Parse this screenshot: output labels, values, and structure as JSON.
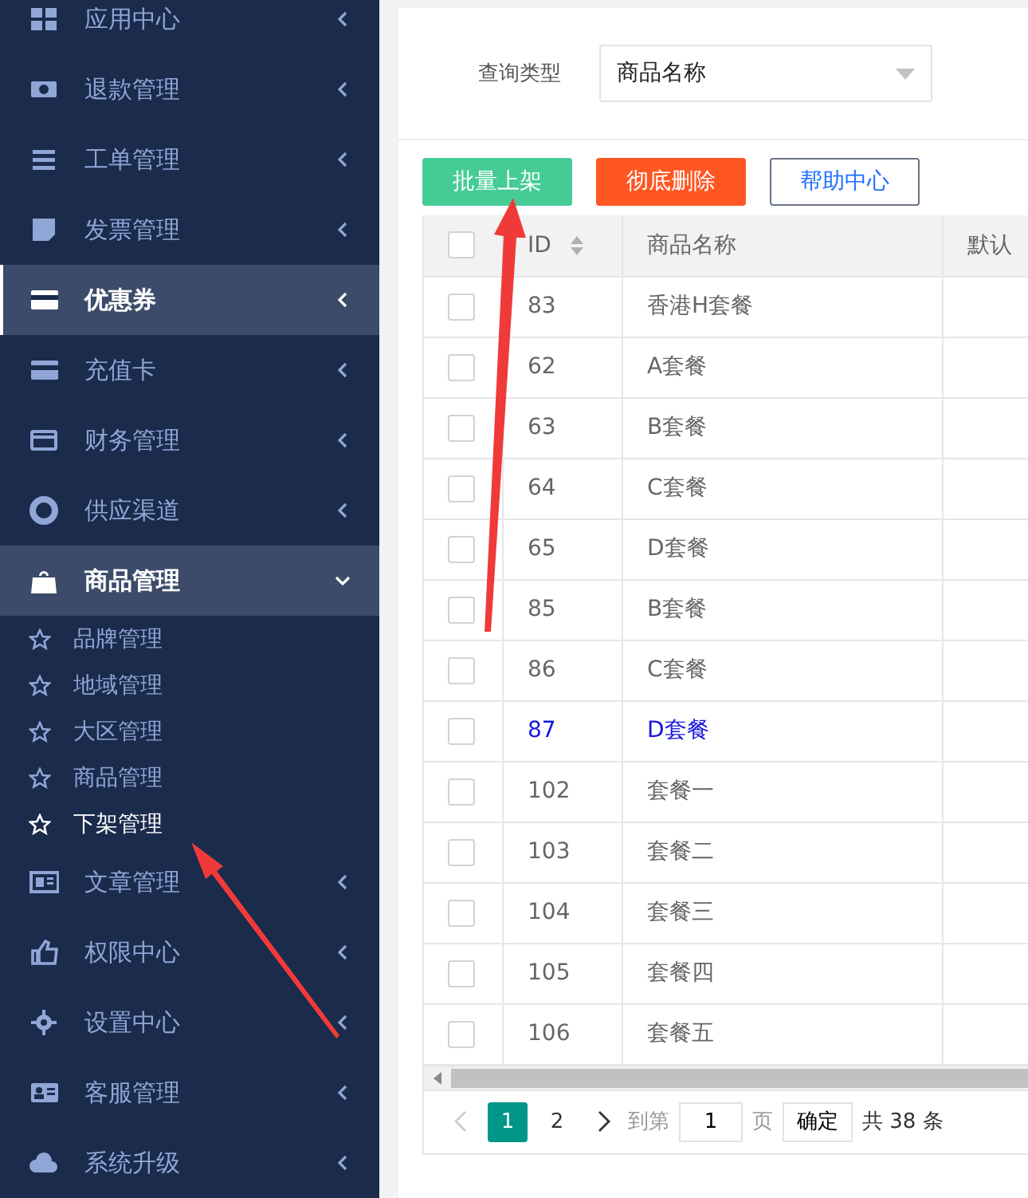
{
  "sidebar": {
    "items": [
      {
        "label": "应用中心",
        "selected": false,
        "expanded": false
      },
      {
        "label": "退款管理",
        "selected": false,
        "expanded": false
      },
      {
        "label": "工单管理",
        "selected": false,
        "expanded": false
      },
      {
        "label": "发票管理",
        "selected": false,
        "expanded": false
      },
      {
        "label": "优惠券",
        "selected": true,
        "expanded": false
      },
      {
        "label": "充值卡",
        "selected": false,
        "expanded": false
      },
      {
        "label": "财务管理",
        "selected": false,
        "expanded": false
      },
      {
        "label": "供应渠道",
        "selected": false,
        "expanded": false
      },
      {
        "label": "商品管理",
        "selected": false,
        "expanded": true,
        "children": [
          {
            "label": "品牌管理",
            "selected": false
          },
          {
            "label": "地域管理",
            "selected": false
          },
          {
            "label": "大区管理",
            "selected": false
          },
          {
            "label": "商品管理",
            "selected": false
          },
          {
            "label": "下架管理",
            "selected": true
          }
        ]
      },
      {
        "label": "文章管理",
        "selected": false,
        "expanded": false
      },
      {
        "label": "权限中心",
        "selected": false,
        "expanded": false
      },
      {
        "label": "设置中心",
        "selected": false,
        "expanded": false
      },
      {
        "label": "客服管理",
        "selected": false,
        "expanded": false
      },
      {
        "label": "系统升级",
        "selected": false,
        "expanded": false
      }
    ]
  },
  "filter": {
    "label": "查询类型",
    "value": "商品名称"
  },
  "buttons": [
    {
      "label": "批量上架",
      "kind": "primary"
    },
    {
      "label": "彻底删除",
      "kind": "danger"
    },
    {
      "label": "帮助中心",
      "kind": "outline"
    }
  ],
  "table": {
    "all_checked": false,
    "columns": [
      "ID",
      "商品名称",
      "默认"
    ],
    "rows": [
      {
        "id": "83",
        "name": "香港H套餐",
        "checked": false,
        "highlighted": false
      },
      {
        "id": "62",
        "name": "A套餐",
        "checked": false,
        "highlighted": false
      },
      {
        "id": "63",
        "name": "B套餐",
        "checked": false,
        "highlighted": false
      },
      {
        "id": "64",
        "name": "C套餐",
        "checked": false,
        "highlighted": false
      },
      {
        "id": "65",
        "name": "D套餐",
        "checked": false,
        "highlighted": false
      },
      {
        "id": "85",
        "name": "B套餐",
        "checked": false,
        "highlighted": false
      },
      {
        "id": "86",
        "name": "C套餐",
        "checked": false,
        "highlighted": false
      },
      {
        "id": "87",
        "name": "D套餐",
        "checked": false,
        "highlighted": true
      },
      {
        "id": "102",
        "name": "套餐一",
        "checked": false,
        "highlighted": false
      },
      {
        "id": "103",
        "name": "套餐二",
        "checked": false,
        "highlighted": false
      },
      {
        "id": "104",
        "name": "套餐三",
        "checked": false,
        "highlighted": false
      },
      {
        "id": "105",
        "name": "套餐四",
        "checked": false,
        "highlighted": false
      },
      {
        "id": "106",
        "name": "套餐五",
        "checked": false,
        "highlighted": false
      }
    ]
  },
  "pagination": {
    "pages": [
      {
        "label": "1",
        "selected": true
      },
      {
        "label": "2",
        "selected": false
      }
    ],
    "goto_label": "到第",
    "goto_value": "1",
    "page_unit": "页",
    "confirm": "确定",
    "total": "共 38 条"
  }
}
